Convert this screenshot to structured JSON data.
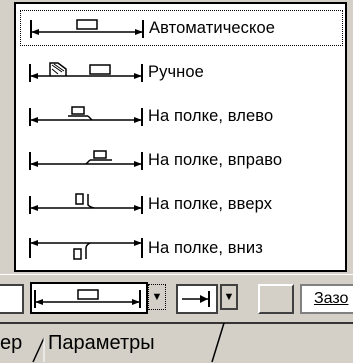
{
  "dropdown": {
    "items": [
      {
        "label": "Автоматическое",
        "icon": "dimension-auto-icon",
        "selected": true
      },
      {
        "label": "Ручное",
        "icon": "dimension-manual-icon",
        "selected": false
      },
      {
        "label": "На полке, влево",
        "icon": "dimension-shelf-left-icon",
        "selected": false
      },
      {
        "label": "На полке, вправо",
        "icon": "dimension-shelf-right-icon",
        "selected": false
      },
      {
        "label": "На полке, вверх",
        "icon": "dimension-shelf-up-icon",
        "selected": false
      },
      {
        "label": "На полке, вниз",
        "icon": "dimension-shelf-down-icon",
        "selected": false
      }
    ]
  },
  "toolbar": {
    "partial_label": "Зазо"
  },
  "tabs": {
    "partial_left": "ер",
    "active": "Параметры"
  }
}
